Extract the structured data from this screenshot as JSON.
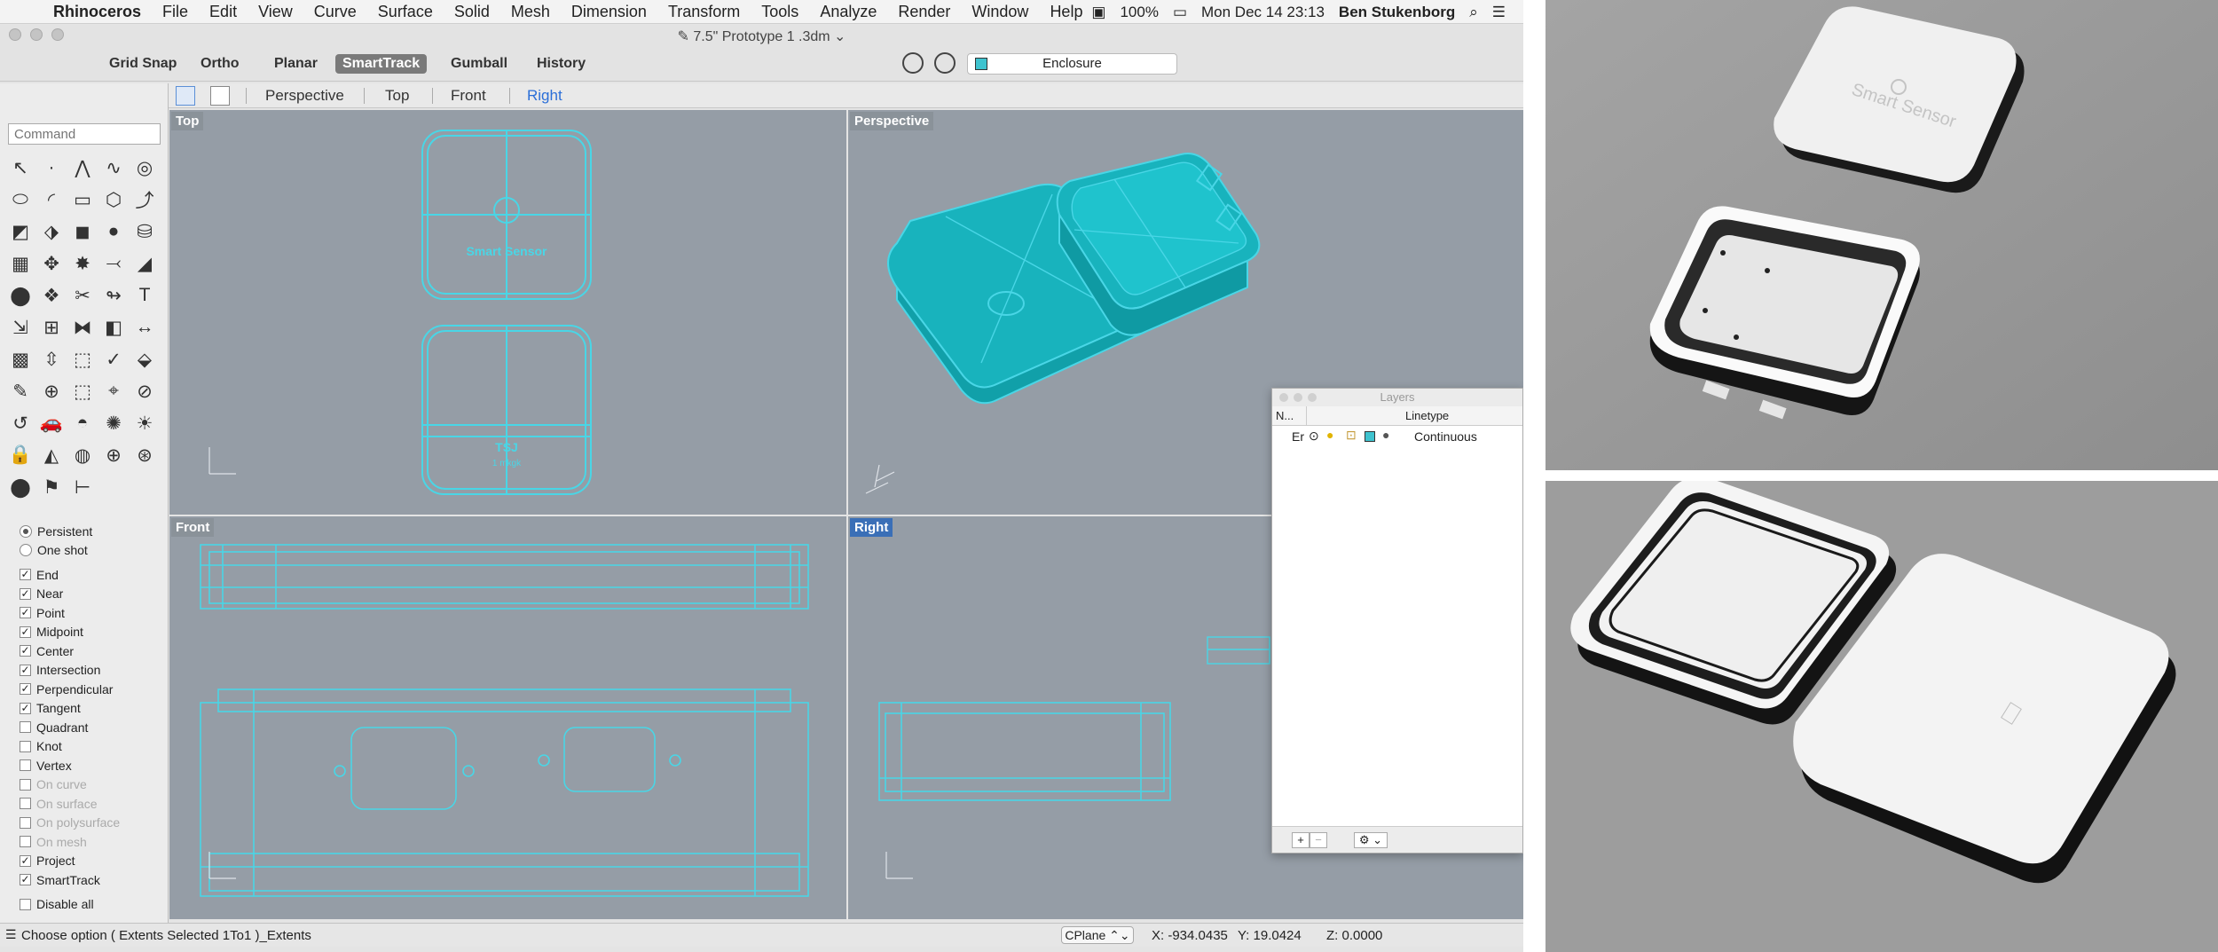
{
  "menubar": {
    "app_name": "Rhinoceros",
    "menus": [
      "File",
      "Edit",
      "View",
      "Curve",
      "Surface",
      "Solid",
      "Mesh",
      "Dimension",
      "Transform",
      "Tools",
      "Analyze",
      "Render",
      "Window",
      "Help"
    ],
    "battery": "100%",
    "datetime": "Mon Dec 14  23:13",
    "user": "Ben Stukenborg"
  },
  "window": {
    "title": "7.5\" Prototype 1 .3dm"
  },
  "toolbar": {
    "buttons": [
      "Grid Snap",
      "Ortho",
      "Planar",
      "SmartTrack",
      "Gumball",
      "History"
    ],
    "active": "SmartTrack",
    "current_layer": "Enclosure"
  },
  "viewport_tabs": [
    "Perspective",
    "Top",
    "Front",
    "Right"
  ],
  "viewport_tab_active": "Right",
  "command": {
    "placeholder": "Command"
  },
  "osnap": {
    "modes": [
      "Persistent",
      "One shot"
    ],
    "items": [
      {
        "label": "End",
        "checked": true,
        "enabled": true
      },
      {
        "label": "Near",
        "checked": true,
        "enabled": true
      },
      {
        "label": "Point",
        "checked": true,
        "enabled": true
      },
      {
        "label": "Midpoint",
        "checked": true,
        "enabled": true
      },
      {
        "label": "Center",
        "checked": true,
        "enabled": true
      },
      {
        "label": "Intersection",
        "checked": true,
        "enabled": true
      },
      {
        "label": "Perpendicular",
        "checked": true,
        "enabled": true
      },
      {
        "label": "Tangent",
        "checked": true,
        "enabled": true
      },
      {
        "label": "Quadrant",
        "checked": false,
        "enabled": true
      },
      {
        "label": "Knot",
        "checked": false,
        "enabled": true
      },
      {
        "label": "Vertex",
        "checked": false,
        "enabled": true
      },
      {
        "label": "On curve",
        "checked": false,
        "enabled": false
      },
      {
        "label": "On surface",
        "checked": false,
        "enabled": false
      },
      {
        "label": "On polysurface",
        "checked": false,
        "enabled": false
      },
      {
        "label": "On mesh",
        "checked": false,
        "enabled": false
      },
      {
        "label": "Project",
        "checked": true,
        "enabled": true
      },
      {
        "label": "SmartTrack",
        "checked": true,
        "enabled": true
      },
      {
        "label": "Disable all",
        "checked": false,
        "enabled": true
      }
    ]
  },
  "viewports": {
    "top": {
      "label": "Top",
      "lid_text": "Smart Sensor",
      "base_text_1": "TSJ",
      "base_text_2": "1 mkgk"
    },
    "perspective": {
      "label": "Perspective"
    },
    "front": {
      "label": "Front"
    },
    "right": {
      "label": "Right"
    }
  },
  "layers_panel": {
    "title": "Layers",
    "col_name": "N...",
    "col_linetype": "Linetype",
    "row_name": "Er",
    "row_linetype": "Continuous",
    "add": "+",
    "remove": "−"
  },
  "statusbar": {
    "prompt": "Choose option ( Extents Selected 1To1 )_Extents",
    "cplane": "CPlane",
    "x": "X: -934.0435",
    "y": "Y: 19.0424",
    "z": "Z: 0.0000"
  },
  "render_text": {
    "lid": "Smart Sensor"
  },
  "colors": {
    "wire": "#49d6e6",
    "shaded": "#18b3bd",
    "viewport_bg": "#959da6",
    "accent": "#3a6fb7"
  }
}
